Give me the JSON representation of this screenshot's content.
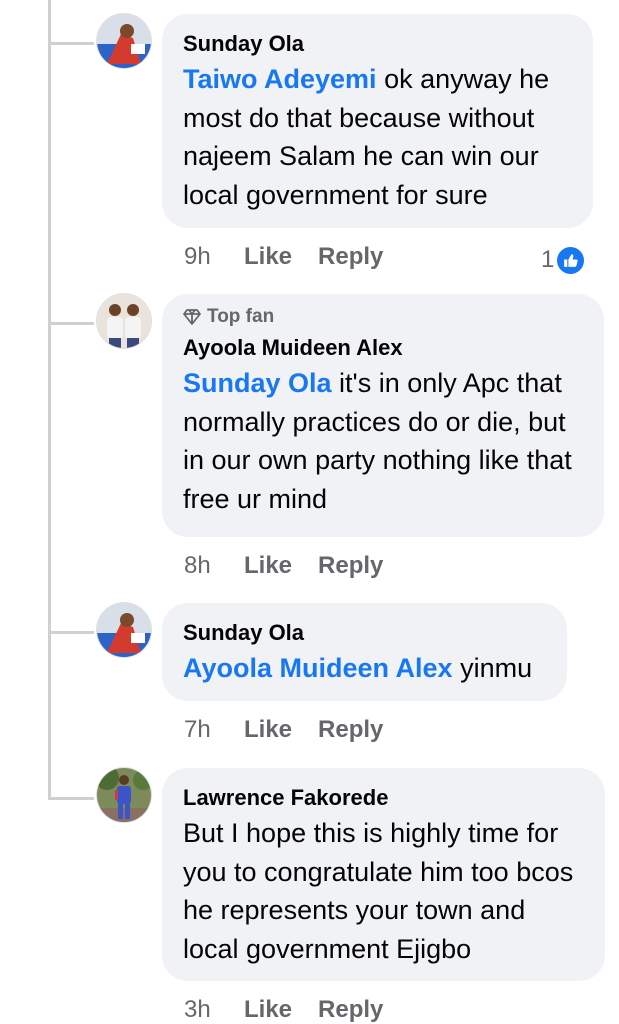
{
  "comments": [
    {
      "author": "Sunday Ola",
      "mention": "Taiwo Adeyemi",
      "text": " ok anyway he most do that because without najeem Salam he can win our local government for sure",
      "time": "9h",
      "like": "Like",
      "reply": "Reply",
      "reaction_count": "1",
      "avatar_icon": "user-photo-icon"
    },
    {
      "badge": "Top fan",
      "author": "Ayoola Muideen Alex",
      "mention": "Sunday Ola",
      "text": " it's in only Apc that normally practices do or die, but in our own party nothing like that free ur mind",
      "time": "8h",
      "like": "Like",
      "reply": "Reply",
      "avatar_icon": "user-photo-icon"
    },
    {
      "author": "Sunday Ola",
      "mention": "Ayoola Muideen Alex",
      "text": " yinmu",
      "time": "7h",
      "like": "Like",
      "reply": "Reply",
      "avatar_icon": "user-photo-icon"
    },
    {
      "author": "Lawrence Fakorede",
      "text": "But I hope this is highly time for you to congratulate him too bcos he represents your town and local government Ejigbo",
      "time": "3h",
      "like": "Like",
      "reply": "Reply",
      "avatar_icon": "user-photo-icon"
    }
  ],
  "colors": {
    "link": "#1877f2",
    "bubble": "#f0f2f5",
    "secondary_text": "#65676b",
    "thread_line": "#ced0d4"
  }
}
